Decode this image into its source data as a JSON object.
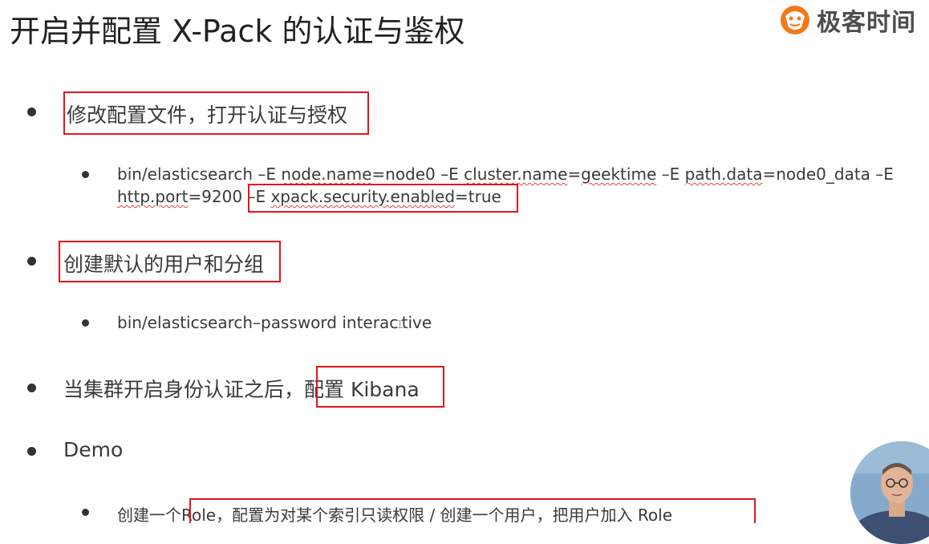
{
  "slide": {
    "title": "开启并配置 X-Pack 的认证与鉴权",
    "logo_text": "极客时间",
    "items": [
      {
        "text": "修改配置文件，打开认证与授权",
        "sub": {
          "line1_a": "bin/elasticsearch ",
          "line1_b": "–E ",
          "line1_c": "node.name",
          "line1_d": "=node0 –E ",
          "line1_e": "cluster.name",
          "line1_f": "=",
          "line1_g": "geektime",
          "line1_h": " –E ",
          "line1_i": "path.data",
          "line1_j": "=node0_data –E",
          "line2_a": "http.port",
          "line2_b": "=9200 ",
          "line2_c": "–E ",
          "line2_d": "xpack.security.enabled",
          "line2_e": "=true"
        }
      },
      {
        "text": "创建默认的用户和分组",
        "sub": {
          "text_a": "bin/elasticsearch–password interac",
          "text_b": "tive"
        }
      },
      {
        "text_a": "当集群开启身份认证之后，",
        "text_b": "配置 Kibana"
      },
      {
        "text": "Demo",
        "sub": {
          "text_a": "创建一个",
          "text_b": "Role，配置为对某个索引只读权限 / 创建一个用户，把用户加入 Role"
        }
      }
    ]
  },
  "colors": {
    "highlight_box": "#e3161b",
    "logo_orange": "#f07a1a"
  },
  "icons": {
    "logo": "geektime-logo-icon",
    "cursor": "text-cursor-icon"
  }
}
